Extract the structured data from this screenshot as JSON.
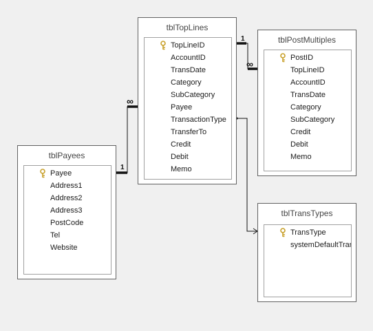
{
  "tables": [
    {
      "id": "tblTopLines",
      "title": "tblTopLines",
      "fields": [
        {
          "name": "TopLineID",
          "key": true
        },
        {
          "name": "AccountID",
          "key": false
        },
        {
          "name": "TransDate",
          "key": false
        },
        {
          "name": "Category",
          "key": false
        },
        {
          "name": "SubCategory",
          "key": false
        },
        {
          "name": "Payee",
          "key": false
        },
        {
          "name": "TransactionType",
          "key": false
        },
        {
          "name": "TransferTo",
          "key": false
        },
        {
          "name": "Credit",
          "key": false
        },
        {
          "name": "Debit",
          "key": false
        },
        {
          "name": "Memo",
          "key": false
        }
      ]
    },
    {
      "id": "tblPostMultiples",
      "title": "tblPostMultiples",
      "fields": [
        {
          "name": "PostID",
          "key": true
        },
        {
          "name": "TopLineID",
          "key": false
        },
        {
          "name": "AccountID",
          "key": false
        },
        {
          "name": "TransDate",
          "key": false
        },
        {
          "name": "Category",
          "key": false
        },
        {
          "name": "SubCategory",
          "key": false
        },
        {
          "name": "Credit",
          "key": false
        },
        {
          "name": "Debit",
          "key": false
        },
        {
          "name": "Memo",
          "key": false
        }
      ]
    },
    {
      "id": "tblPayees",
      "title": "tblPayees",
      "fields": [
        {
          "name": "Payee",
          "key": true
        },
        {
          "name": "Address1",
          "key": false
        },
        {
          "name": "Address2",
          "key": false
        },
        {
          "name": "Address3",
          "key": false
        },
        {
          "name": "PostCode",
          "key": false
        },
        {
          "name": "Tel",
          "key": false
        },
        {
          "name": "Website",
          "key": false
        }
      ]
    },
    {
      "id": "tblTransTypes",
      "title": "tblTransTypes",
      "fields": [
        {
          "name": "TransType",
          "key": true
        },
        {
          "name": "systemDefaultTrans",
          "key": false
        }
      ]
    }
  ],
  "relationships": [
    {
      "from": "tblTopLines.TopLineID",
      "to": "tblPostMultiples.TopLineID",
      "one_label": "1",
      "many_label": "∞"
    },
    {
      "from": "tblPayees.Payee",
      "to": "tblTopLines.Payee",
      "one_label": "1",
      "many_label": "∞"
    },
    {
      "from": "tblTransTypes.TransType",
      "to": "tblTopLines.TransactionType",
      "one_label": "",
      "many_label": ""
    }
  ],
  "icons": {
    "primary_key": "key-icon"
  },
  "colors": {
    "canvas": "#f0f0f0",
    "border": "#606060",
    "key_gold": "#c8a02a"
  }
}
